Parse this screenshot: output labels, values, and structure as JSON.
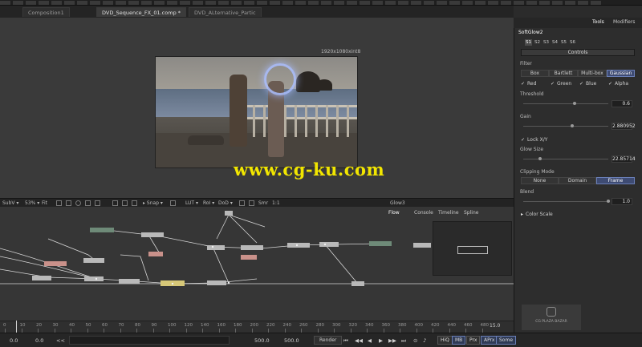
{
  "tabs": [
    {
      "label": "Composition1",
      "active": false
    },
    {
      "label": "DVD_Sequence_FX_01.comp *",
      "active": true
    },
    {
      "label": "DVD_ALternative_Partic",
      "active": false
    }
  ],
  "viewer": {
    "resolution": "1920x1080xint8",
    "watermark": "www.cg-ku.com"
  },
  "viewer_toolbar": {
    "subv": "SubV ▾",
    "zoom": "53% ▾",
    "fit": "Fit",
    "snap": "▸ Snap ▾",
    "lut": "LUT ▾",
    "roi": "RoI ▾",
    "dod": "DoD ▾",
    "smr": "Smr",
    "ratio": "1:1",
    "tool_name": "Glow3"
  },
  "flow_tabs": [
    "Flow",
    "Console",
    "Timeline",
    "Spline"
  ],
  "ruler": {
    "ticks": [
      "0",
      "10",
      "20",
      "30",
      "40",
      "50",
      "60",
      "70",
      "80",
      "90",
      "100",
      "120",
      "140",
      "160",
      "180",
      "200",
      "220",
      "240",
      "260",
      "280",
      "300",
      "320",
      "340",
      "360",
      "380",
      "400",
      "420",
      "440",
      "460",
      "480"
    ],
    "end_value": "15.0"
  },
  "transport": {
    "current_time": "0.0",
    "start_time": "0.0",
    "back_symbol": "<<",
    "end_time": "500.0",
    "render_end": "500.0",
    "render_label": "Render",
    "hiq": "HiQ",
    "mb": "MB",
    "prx": "Prx",
    "aprx": "APrx",
    "some": "Some"
  },
  "panel": {
    "tabs": [
      "Tools",
      "Modifiers"
    ],
    "tool_title": "SoftGlow2",
    "subtabs": [
      "S1",
      "S2",
      "S3",
      "S4",
      "S5",
      "S6"
    ],
    "controls_label": "Controls",
    "filter": {
      "label": "Filter",
      "options": [
        "Box",
        "Bartlett",
        "Multi-box",
        "Gaussian"
      ],
      "selected": "Gaussian"
    },
    "channels": [
      "Red",
      "Green",
      "Blue",
      "Alpha"
    ],
    "threshold": {
      "label": "Threshold",
      "value": "0.6",
      "fraction": 0.6
    },
    "gain": {
      "label": "Gain",
      "value": "2.880952",
      "fraction": 0.58
    },
    "lock_xy": "Lock X/Y",
    "glow_size": {
      "label": "Glow Size",
      "value": "22.85714",
      "fraction": 0.2
    },
    "clipping_mode": {
      "label": "Clipping Mode",
      "options": [
        "None",
        "Domain",
        "Frame"
      ],
      "selected": "Frame"
    },
    "blend": {
      "label": "Blend",
      "value": "1.0",
      "fraction": 1.0
    },
    "color_scale": "Color Scale"
  },
  "logo_text": "CG PLAZA BAZAR"
}
